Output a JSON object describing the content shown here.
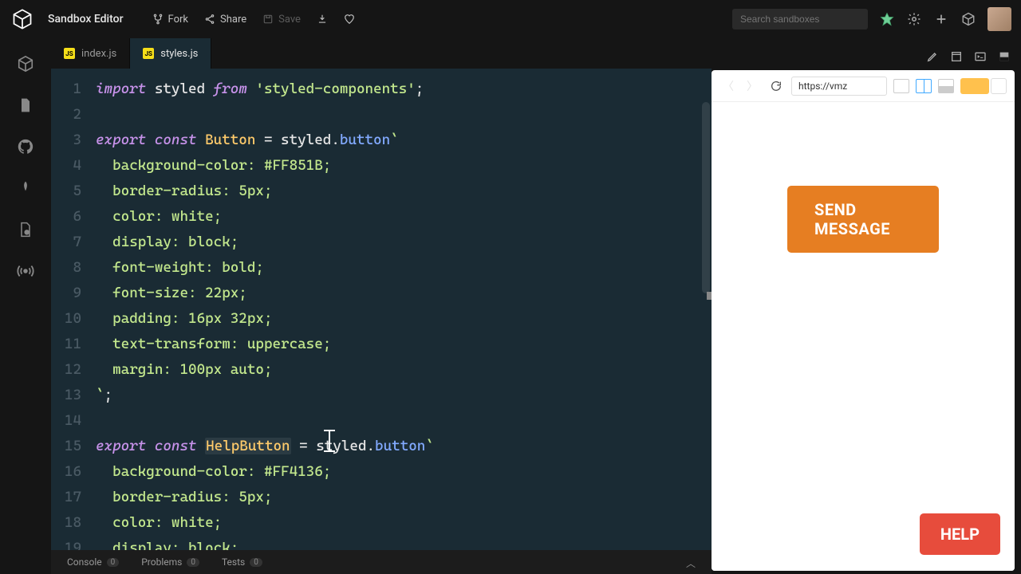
{
  "header": {
    "title": "Sandbox Editor",
    "fork": "Fork",
    "share": "Share",
    "save": "Save",
    "search_placeholder": "Search sandboxes"
  },
  "tabs": [
    {
      "label": "index.js",
      "active": false
    },
    {
      "label": "styles.js",
      "active": true
    }
  ],
  "code": {
    "lines": [
      1,
      2,
      3,
      4,
      5,
      6,
      7,
      8,
      9,
      10,
      11,
      12,
      13,
      14,
      15,
      16,
      17,
      18,
      19
    ]
  },
  "bottom": {
    "console": "Console",
    "console_count": "0",
    "problems": "Problems",
    "problems_count": "0",
    "tests": "Tests",
    "tests_count": "0"
  },
  "preview": {
    "url": "https://vmz",
    "send_label": "SEND MESSAGE",
    "help_label": "HELP"
  },
  "source": {
    "file": "styles.js",
    "content": "import styled from 'styled-components';\n\nexport const Button = styled.button`\n  background-color: #FF851B;\n  border-radius: 5px;\n  color: white;\n  display: block;\n  font-weight: bold;\n  font-size: 22px;\n  padding: 16px 32px;\n  text-transform: uppercase;\n  margin: 100px auto;\n`;\n\nexport const HelpButton = styled.button`\n  background-color: #FF4136;\n  border-radius: 5px;\n  color: white;\n  display: block;"
  }
}
